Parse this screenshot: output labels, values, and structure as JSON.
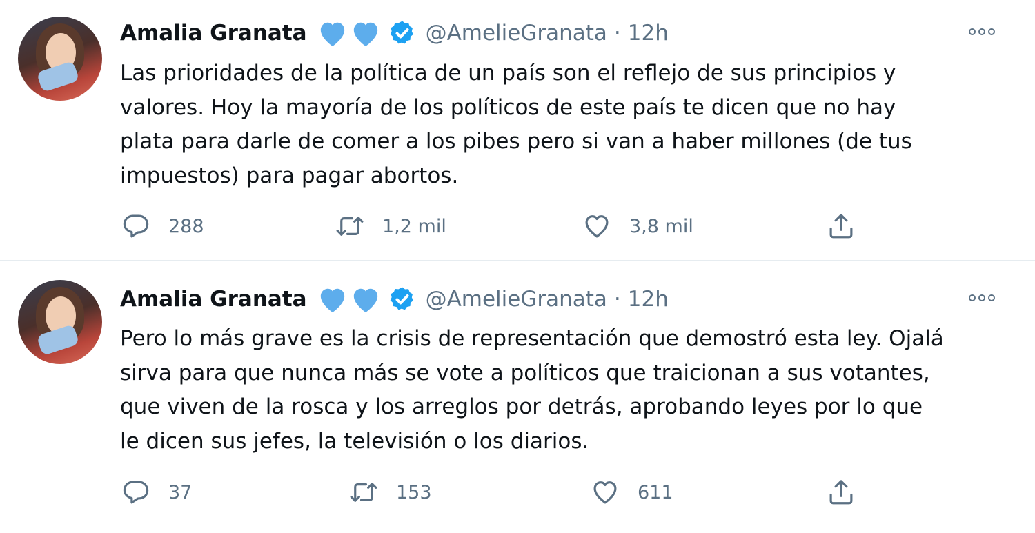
{
  "colors": {
    "text": "#0f1419",
    "secondary": "#5b7083",
    "verified": "#1da1f2",
    "heart_emoji": "#5dadec",
    "divider": "#e6ecf0"
  },
  "tweets": [
    {
      "author_name": "Amalia Granata",
      "handle": "@AmelieGranata",
      "separator": "·",
      "time": "12h",
      "emoji": [
        "blue-heart",
        "blue-heart"
      ],
      "text": "Las prioridades de la política de un país son el reflejo de sus principios y\nvalores. Hoy la mayoría de los políticos de este país te dicen que no hay\nplata para darle de comer a los pibes pero si van a haber millones (de tus\nimpuestos) para pagar abortos.",
      "replies": "288",
      "retweets": "1,2 mil",
      "likes": "3,8 mil"
    },
    {
      "author_name": "Amalia Granata",
      "handle": "@AmelieGranata",
      "separator": "·",
      "time": "12h",
      "emoji": [
        "blue-heart",
        "blue-heart"
      ],
      "text": "Pero lo más grave es la crisis de representación que demostró esta ley. Ojalá\nsirva para que nunca más se vote a políticos que traicionan a sus votantes,\nque viven de la rosca y los arreglos por detrás, aprobando leyes por lo que\nle dicen sus jefes, la televisión o los diarios.",
      "replies": "37",
      "retweets": "153",
      "likes": "611"
    }
  ]
}
